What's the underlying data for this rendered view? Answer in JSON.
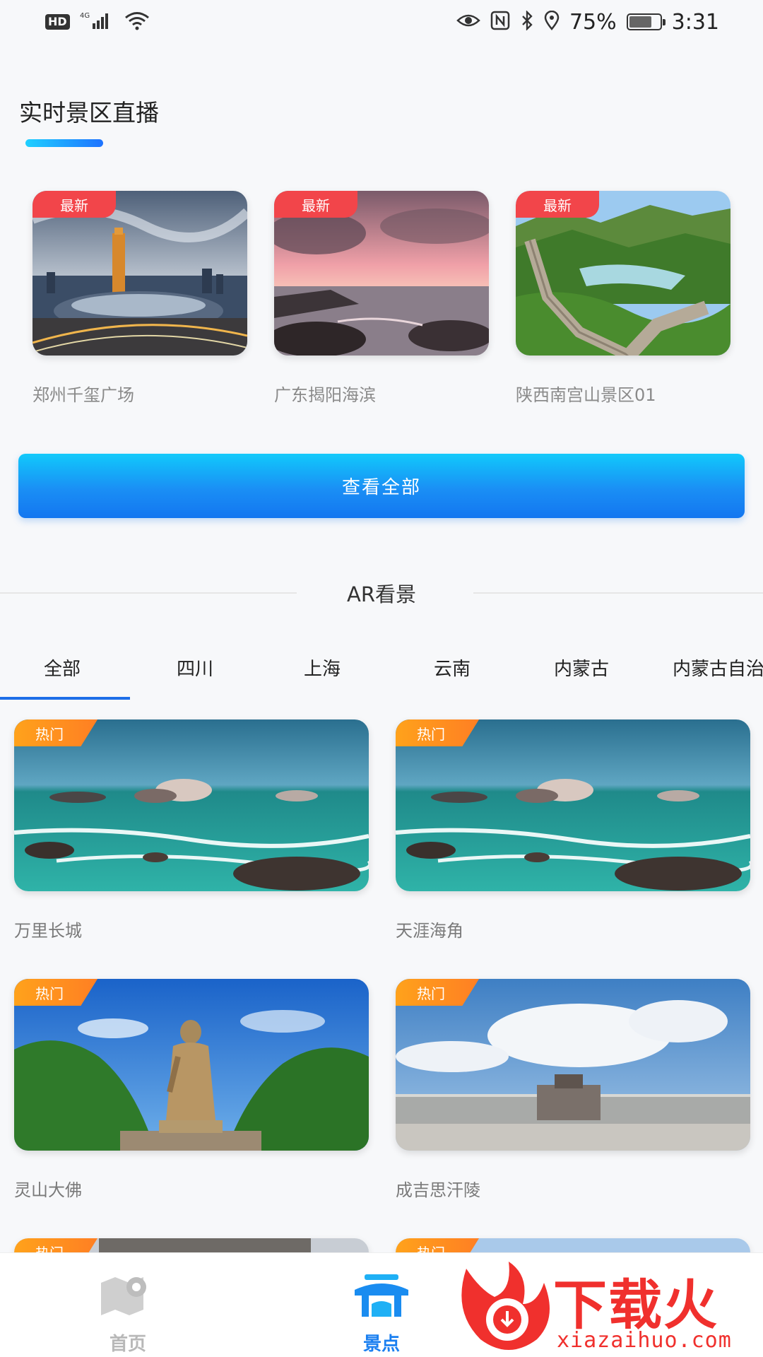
{
  "status_bar": {
    "hd": "HD",
    "network": "4G",
    "battery": "75%",
    "battery_level": 0.75,
    "time": "3:31"
  },
  "live_section": {
    "title": "实时景区直播",
    "cards": [
      {
        "badge": "最新",
        "name": "郑州千玺广场"
      },
      {
        "badge": "最新",
        "name": "广东揭阳海滨"
      },
      {
        "badge": "最新",
        "name": "陕西南宫山景区01"
      }
    ],
    "view_all_label": "查看全部"
  },
  "ar_section": {
    "title": "AR看景",
    "tabs": [
      "全部",
      "四川",
      "上海",
      "云南",
      "内蒙古",
      "内蒙古自治"
    ],
    "active_tab": "全部",
    "cards": [
      {
        "badge": "热门",
        "name": "万里长城"
      },
      {
        "badge": "热门",
        "name": "天涯海角"
      },
      {
        "badge": "热门",
        "name": "灵山大佛"
      },
      {
        "badge": "热门",
        "name": "成吉思汗陵"
      },
      {
        "badge": "热门",
        "name": ""
      },
      {
        "badge": "热门",
        "name": ""
      }
    ]
  },
  "bottom_nav": {
    "items": [
      {
        "label": "首页",
        "icon": "map-pin-icon",
        "active": false
      },
      {
        "label": "景点",
        "icon": "pavilion-icon",
        "active": true
      }
    ]
  },
  "watermark": {
    "text": "下载火",
    "url": "xiazaihuo.com"
  },
  "colors": {
    "accent": "#1e73ff",
    "badge_new": "#f2454a",
    "badge_hot": "#ff8c1f",
    "watermark": "#f0302d"
  }
}
